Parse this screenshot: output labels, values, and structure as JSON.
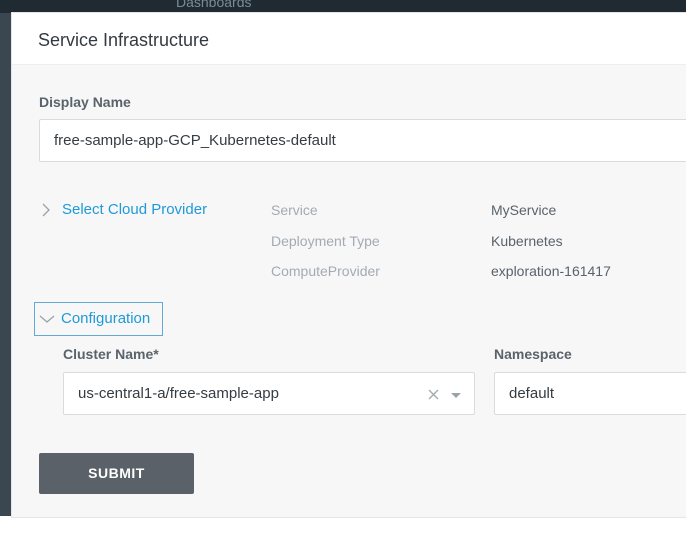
{
  "background": {
    "logo_text": "",
    "nav_link": "Dashboards"
  },
  "modal": {
    "title": "Service Infrastructure",
    "display_name": {
      "label": "Display Name",
      "value": "free-sample-app-GCP_Kubernetes-default"
    },
    "cloud_provider": {
      "link_label": "Select Cloud Provider",
      "summary": [
        {
          "key": "Service",
          "value": "MyService"
        },
        {
          "key": "Deployment Type",
          "value": "Kubernetes"
        },
        {
          "key": "ComputeProvider",
          "value": "exploration-161417"
        }
      ]
    },
    "configuration": {
      "toggle_label": "Configuration",
      "cluster_name": {
        "label": "Cluster Name*",
        "value": "us-central1-a/free-sample-app"
      },
      "namespace": {
        "label": "Namespace",
        "value": "default"
      }
    },
    "submit_label": "SUBMIT"
  },
  "icons": {
    "collapsed": "chevron-right-icon",
    "expanded": "chevron-down-icon",
    "clear": "clear-icon",
    "dropdown": "caret-down-icon"
  },
  "colors": {
    "accent_link": "#1f9ad6",
    "focus_border": "#63a9d6",
    "submit_bg": "#5a6168",
    "modal_bg": "#f7f7f8"
  }
}
